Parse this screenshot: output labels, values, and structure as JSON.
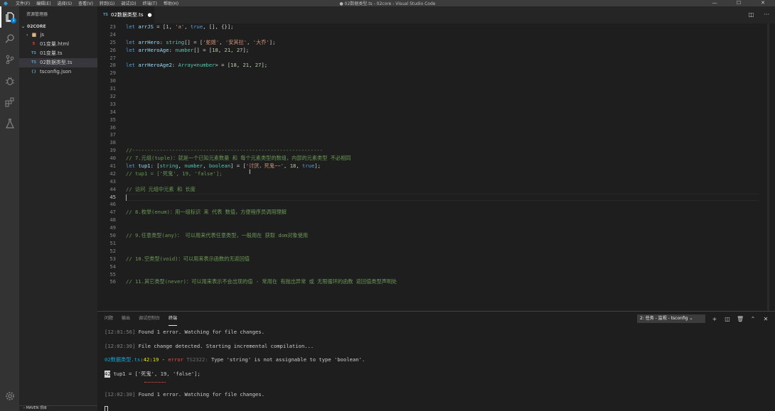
{
  "titlebar": {
    "menu": [
      "文件(F)",
      "编辑(E)",
      "选择(S)",
      "查看(V)",
      "转到(G)",
      "调试(D)",
      "终端(T)",
      "帮助(H)"
    ],
    "window_title": "● 02数据类型.ts - 02core - Visual Studio Code",
    "controls": [
      "—",
      "☐",
      "✕"
    ]
  },
  "activitybar": {
    "items": [
      "explorer-icon",
      "search-icon",
      "source-control-icon",
      "debug-icon",
      "extensions-icon",
      "test-icon"
    ],
    "badge": "1"
  },
  "sidebar": {
    "title": "资源管理器",
    "section": "02CORE",
    "files": [
      {
        "icon": "folder",
        "name": "js",
        "depth": 1
      },
      {
        "icon": "html",
        "name": "01变量.html",
        "depth": 2
      },
      {
        "icon": "ts",
        "name": "01变量.ts",
        "depth": 2
      },
      {
        "icon": "ts",
        "name": "02数据类型.ts",
        "depth": 2
      },
      {
        "icon": "json",
        "name": "tsconfig.json",
        "depth": 2
      }
    ],
    "footer": "MAVEN 项目"
  },
  "tabs": [
    {
      "label": "02数据类型.ts",
      "badge": "TS",
      "modified": "●"
    }
  ],
  "editor": {
    "current_line": 45
  },
  "panel": {
    "tabs": [
      "问题",
      "输出",
      "调试控制台",
      "终端"
    ],
    "active_tab": "终端",
    "terminal_select": "2: 任务 - 监视 - tsconfig",
    "lines": {
      "l1_time": "[12:01:56]",
      "l1_msg": " Found 1 error. Watching for file changes.",
      "l2_time": "[12:02:30]",
      "l2_msg": " File change detected. Starting incremental compilation...",
      "l3_file": "02数据类型.ts",
      "l3_pos": ":42:19",
      "l3_sep": " - ",
      "l3_err": "error",
      "l3_code": " TS2322: ",
      "l3_msg": "Type 'string' is not assignable to type 'boolean'.",
      "l4_num": "42",
      "l4_code": " tup1 = ['死鬼', 19, 'false'];",
      "l5_time": "[12:02:30]",
      "l5_msg": " Found 1 error. Watching for file changes."
    }
  }
}
